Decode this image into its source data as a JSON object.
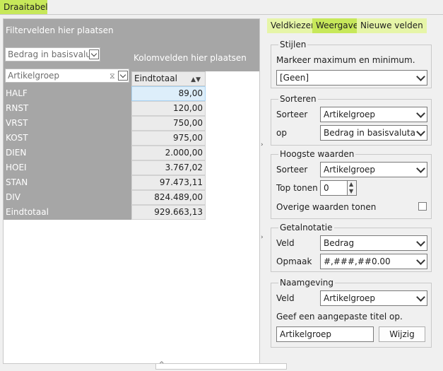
{
  "title_tab": "Draaitabel",
  "pivot": {
    "filter_area_label": "Filtervelden hier plaatsen",
    "column_area_label": "Kolomvelden hier plaatsen",
    "value_field": "Bedrag in basisvaluta",
    "row_field": "Artikelgroep",
    "column_header": "Eindtotaal",
    "rows": [
      {
        "label": "HALF",
        "value": "89,00"
      },
      {
        "label": "RNST",
        "value": "120,00"
      },
      {
        "label": "VRST",
        "value": "750,00"
      },
      {
        "label": "KOST",
        "value": "975,00"
      },
      {
        "label": "DIEN",
        "value": "2.000,00"
      },
      {
        "label": "HOEI",
        "value": "3.767,02"
      },
      {
        "label": "STAN",
        "value": "97.473,11"
      },
      {
        "label": "DIV",
        "value": "824.489,00"
      },
      {
        "label": "Eindtotaal",
        "value": "929.663,13"
      }
    ]
  },
  "tabs": {
    "veldkiezer": "Veldkiezer",
    "weergave": "Weergave",
    "nieuwe_velden": "Nieuwe velden"
  },
  "stijlen": {
    "title": "Stijlen",
    "label": "Markeer maximum en minimum.",
    "value": "[Geen]"
  },
  "sorteren": {
    "title": "Sorteren",
    "sorteer_label": "Sorteer",
    "sorteer_value": "Artikelgroep",
    "op_label": "op",
    "op_value": "Bedrag in basisvaluta"
  },
  "hoogste": {
    "title": "Hoogste waarden",
    "sorteer_label": "Sorteer",
    "sorteer_value": "Artikelgroep",
    "top_label": "Top tonen",
    "top_value": "0",
    "overige_label": "Overige waarden tonen"
  },
  "getalnotatie": {
    "title": "Getalnotatie",
    "veld_label": "Veld",
    "veld_value": "Bedrag",
    "opmaak_label": "Opmaak",
    "opmaak_value": "#,###,##0.00"
  },
  "naamgeving": {
    "title": "Naamgeving",
    "veld_label": "Veld",
    "veld_value": "Artikelgroep",
    "hint": "Geef een aangepaste titel op.",
    "title_value": "Artikelgroep",
    "button": "Wijzig"
  }
}
